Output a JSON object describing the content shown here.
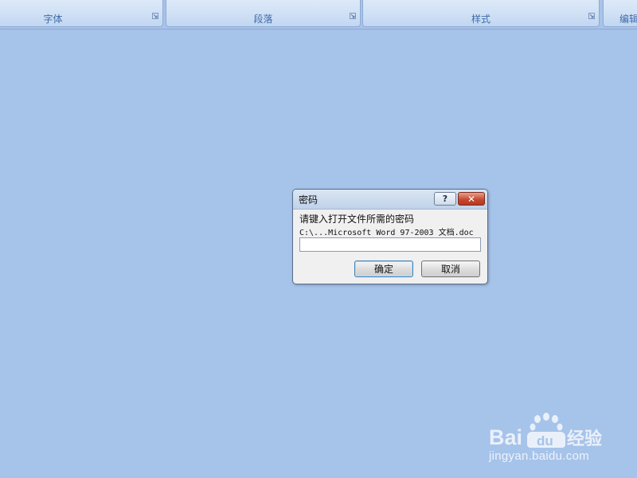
{
  "ribbon": {
    "groups": [
      {
        "label": "字体"
      },
      {
        "label": "段落"
      },
      {
        "label": "样式"
      },
      {
        "label": "编辑"
      }
    ]
  },
  "dialog": {
    "title": "密码",
    "help_symbol": "?",
    "close_symbol": "✕",
    "prompt": "请键入打开文件所需的密码",
    "file_path": "C:\\...Microsoft Word 97-2003 文档.doc",
    "password_value": "",
    "ok_label": "确定",
    "cancel_label": "取消"
  },
  "watermark": {
    "logo_text": "Baidu经验",
    "url": "jingyan.baidu.com"
  },
  "colors": {
    "background": "#a6c3ea",
    "ribbon_label": "#3e6aa8",
    "close_button": "#c4452c"
  }
}
